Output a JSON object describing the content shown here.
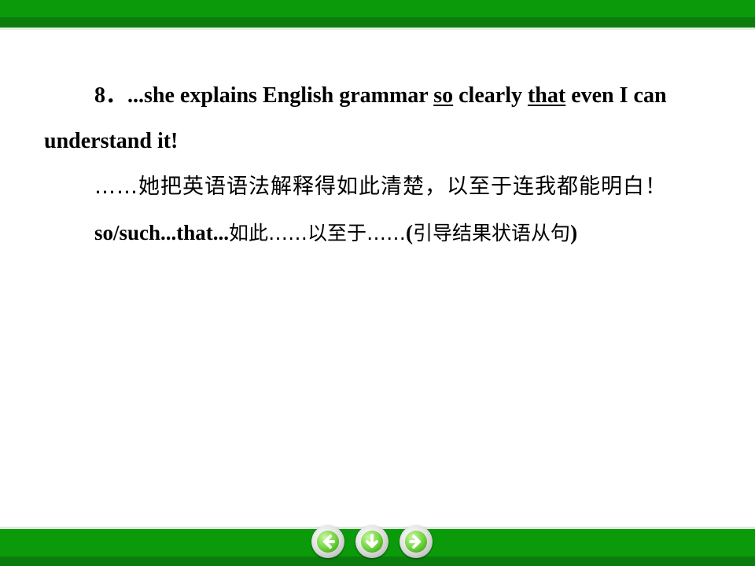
{
  "slide": {
    "item_number": "8．",
    "sentence_part1": "...she explains English grammar ",
    "sentence_so": "so",
    "sentence_part2": " clearly ",
    "sentence_that": "that",
    "sentence_part3": " even I can understand it!",
    "translation": "……她把英语语法解释得如此清楚，以至于连我都能明白！",
    "note_pattern": "so/such...that...",
    "note_meaning": "如此……以至于……",
    "note_open_paren": "(",
    "note_explanation": "引导结果状语从句",
    "note_close_paren": ")"
  },
  "navigation": {
    "prev_icon": "arrow-left-icon",
    "down_icon": "arrow-down-icon",
    "next_icon": "arrow-right-icon"
  },
  "colors": {
    "band_green": "#0a9a0a",
    "band_dark_green": "#0c7d0c",
    "button_green": "#6cd23a"
  }
}
